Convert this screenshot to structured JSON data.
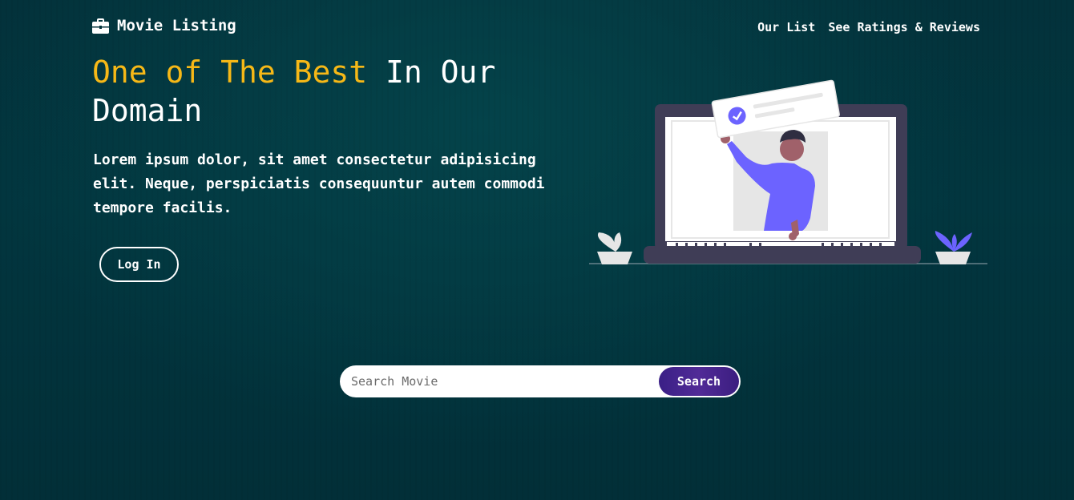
{
  "brand": {
    "name": "Movie Listing",
    "icon": "briefcase-icon"
  },
  "nav": {
    "items": [
      {
        "label": "Our List"
      },
      {
        "label": "See Ratings & Reviews"
      }
    ]
  },
  "hero": {
    "title_accent": "One of The Best",
    "title_rest": " In Our Domain",
    "description": "Lorem ipsum dolor, sit amet consectetur adipisicing elit. Neque, perspiciatis consequuntur autem commodi tempore facilis.",
    "login_label": "Log In"
  },
  "search": {
    "placeholder": "Search Movie",
    "button_label": "Search"
  },
  "colors": {
    "accent": "#f6b817",
    "button_purple": "#3a1f86",
    "figure_purple": "#6c63ff",
    "laptop": "#3f3d56"
  }
}
